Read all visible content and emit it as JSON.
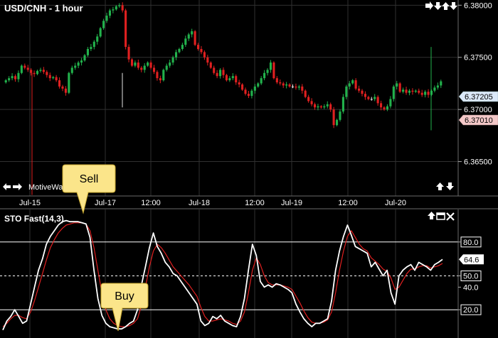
{
  "price_panel": {
    "title": "USD/CNH - 1 hour",
    "indicator_label": "MotiveWave",
    "nav_icons": [
      "arrow-right-icon",
      "arrow-down-icon",
      "arrow-up-icon",
      "arrow-down-icon"
    ],
    "scroll_icons": [
      "arrow-up-icon",
      "arrow-down-icon"
    ],
    "left_icons": [
      "arrow-left-icon",
      "arrow-right-icon"
    ],
    "last_price": "6.37205",
    "last_price_color": "#dbe8f8",
    "alt_price": "6.37010",
    "alt_price_color": "#f4c8c8"
  },
  "time_axis": {
    "labels": [
      "Jul-15",
      "Jul-17",
      "12:00",
      "Jul-18",
      "12:00",
      "Jul-19",
      "12:00",
      "Jul-20"
    ]
  },
  "osc_panel": {
    "title": "STO Fast(14,3)",
    "icons": [
      "arrow-up-icon",
      "window-icon",
      "close-icon"
    ],
    "current_value": "64.6",
    "levels": [
      "80.0",
      "50.0",
      "20.0"
    ]
  },
  "callouts": [
    {
      "label": "Sell"
    },
    {
      "label": "Buy"
    }
  ],
  "colors": {
    "up_candle": "#22b24c",
    "down_candle": "#e02020",
    "flat_candle": "#e6e6e6",
    "k_line": "#ffffff",
    "d_line": "#e02020",
    "callout_fill": "#fbe58a",
    "grid": "#303030"
  },
  "chart_data": [
    {
      "type": "candlestick",
      "title": "USD/CNH - 1 hour",
      "ylim": [
        6.3617,
        6.3805
      ],
      "yticks": [
        "6.38000",
        "6.37500",
        "6.37000",
        "6.36500"
      ],
      "x_labels": [
        "Jul-15",
        "Jul-17",
        "12:00",
        "Jul-18",
        "12:00",
        "Jul-19",
        "12:00",
        "Jul-20"
      ],
      "close_series": [
        6.3728,
        6.373,
        6.3732,
        6.3729,
        6.3735,
        6.3742,
        6.374,
        6.3738,
        6.3735,
        6.3734,
        6.3737,
        6.3738,
        6.3736,
        6.3733,
        6.373,
        6.3731,
        6.3728,
        6.3722,
        6.372,
        6.3716,
        6.3735,
        6.374,
        6.3742,
        6.3745,
        6.3747,
        6.3752,
        6.3758,
        6.376,
        6.3765,
        6.377,
        6.3778,
        6.3785,
        6.379,
        6.3795,
        6.3796,
        6.3799,
        6.38,
        6.3795,
        6.376,
        6.3748,
        6.3742,
        6.3745,
        6.374,
        6.3738,
        6.3742,
        6.3745,
        6.374,
        6.3736,
        6.373,
        6.3728,
        6.3738,
        6.3742,
        6.3745,
        6.375,
        6.3755,
        6.3758,
        6.3762,
        6.3768,
        6.3772,
        6.3775,
        6.3762,
        6.3758,
        6.3755,
        6.375,
        6.3745,
        6.374,
        6.3735,
        6.3732,
        6.3738,
        6.3733,
        6.3728,
        6.373,
        6.3732,
        6.3726,
        6.3724,
        6.3719,
        6.3715,
        6.3713,
        6.3718,
        6.3722,
        6.3725,
        6.373,
        6.3735,
        6.3738,
        6.3745,
        6.373,
        6.3726,
        6.3725,
        6.3723,
        6.3724,
        6.3722,
        6.3722,
        6.3721,
        6.3722,
        6.3718,
        6.3712,
        6.3708,
        6.3705,
        6.3702,
        6.3703,
        6.3702,
        6.3703,
        6.3705,
        6.37,
        6.3685,
        6.369,
        6.3698,
        6.3712,
        6.3722,
        6.3725,
        6.3728,
        6.372,
        6.3718,
        6.3715,
        6.3712,
        6.371,
        6.371,
        6.3712,
        6.3706,
        6.3702,
        6.37,
        6.3703,
        6.371,
        6.3722,
        6.3725,
        6.3717,
        6.3719,
        6.3716,
        6.3718,
        6.3717,
        6.3718,
        6.3716,
        6.3714,
        6.3717,
        6.3714,
        6.3718,
        6.3721,
        6.3723,
        6.3727
      ]
    },
    {
      "type": "line",
      "title": "STO Fast(14,3)",
      "ylim": [
        0,
        100
      ],
      "yticks": [
        "80.0",
        "50.0",
        "40.0",
        "20.0"
      ],
      "reference_lines": [
        80,
        50,
        20
      ],
      "series": [
        {
          "values": [
            2,
            10,
            14,
            20,
            14,
            8,
            10,
            25,
            40,
            55,
            65,
            78,
            85,
            90,
            95,
            98,
            99,
            98,
            98,
            98,
            97,
            96,
            84,
            55,
            30,
            15,
            8,
            5,
            4,
            3,
            3,
            5,
            8,
            10,
            20,
            42,
            58,
            75,
            88,
            76,
            70,
            62,
            58,
            52,
            50,
            45,
            40,
            35,
            30,
            25,
            10,
            6,
            8,
            14,
            12,
            15,
            10,
            8,
            6,
            5,
            14,
            30,
            55,
            78,
            68,
            45,
            40,
            42,
            40,
            43,
            42,
            40,
            38,
            35,
            25,
            18,
            12,
            8,
            5,
            8,
            8,
            10,
            12,
            28,
            55,
            72,
            85,
            95,
            86,
            76,
            74,
            72,
            70,
            58,
            62,
            56,
            50,
            55,
            35,
            25,
            50,
            55,
            58,
            60,
            55,
            62,
            60,
            58,
            55,
            60,
            62,
            64.6
          ]
        },
        {
          "values": [
            5,
            8,
            12,
            15,
            15,
            13,
            12,
            18,
            28,
            40,
            52,
            64,
            75,
            82,
            88,
            92,
            95,
            96,
            97,
            97,
            97,
            96,
            90,
            75,
            55,
            35,
            20,
            12,
            8,
            6,
            5,
            5,
            6,
            8,
            12,
            24,
            40,
            58,
            72,
            78,
            75,
            70,
            64,
            58,
            54,
            50,
            46,
            42,
            37,
            32,
            22,
            14,
            10,
            10,
            11,
            12,
            11,
            10,
            8,
            7,
            10,
            18,
            35,
            55,
            66,
            60,
            50,
            44,
            42,
            42,
            42,
            41,
            40,
            38,
            32,
            26,
            19,
            13,
            9,
            8,
            8,
            9,
            11,
            18,
            35,
            55,
            72,
            85,
            90,
            84,
            78,
            74,
            72,
            66,
            63,
            60,
            56,
            54,
            48,
            38,
            40,
            46,
            52,
            56,
            56,
            58,
            59,
            59,
            57,
            58,
            59,
            61
          ]
        }
      ]
    }
  ]
}
